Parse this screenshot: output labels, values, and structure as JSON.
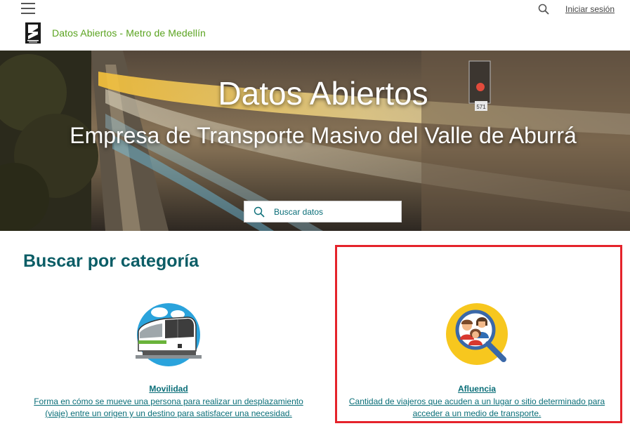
{
  "header": {
    "signin_label": "Iniciar sesión",
    "site_title": "Datos Abiertos - Metro de Medellín"
  },
  "hero": {
    "title": "Datos Abiertos",
    "subtitle": "Empresa de Transporte Masivo del Valle de Aburrá",
    "search_placeholder": "Buscar datos",
    "signal_text": "571"
  },
  "categories": {
    "heading": "Buscar por categoría",
    "items": [
      {
        "title": "Movilidad",
        "desc_line1": "Forma en cómo se mueve una persona para realizar un desplazamiento",
        "desc_line2": "(viaje) entre un origen y un destino para satisfacer una necesidad."
      },
      {
        "title": "Afluencia",
        "desc_line1": "Cantidad de viajeros que acuden a un lugar o sitio determinado para",
        "desc_line2": "acceder a un medio de transporte."
      }
    ]
  },
  "colors": {
    "brand_green": "#5aa31f",
    "teal": "#0a6e78",
    "heading_teal": "#0b5d66",
    "highlight_red": "#e5232b"
  },
  "icons": [
    "hamburger-menu-icon",
    "search-icon",
    "metro-logo",
    "train-icon",
    "people-search-icon"
  ]
}
